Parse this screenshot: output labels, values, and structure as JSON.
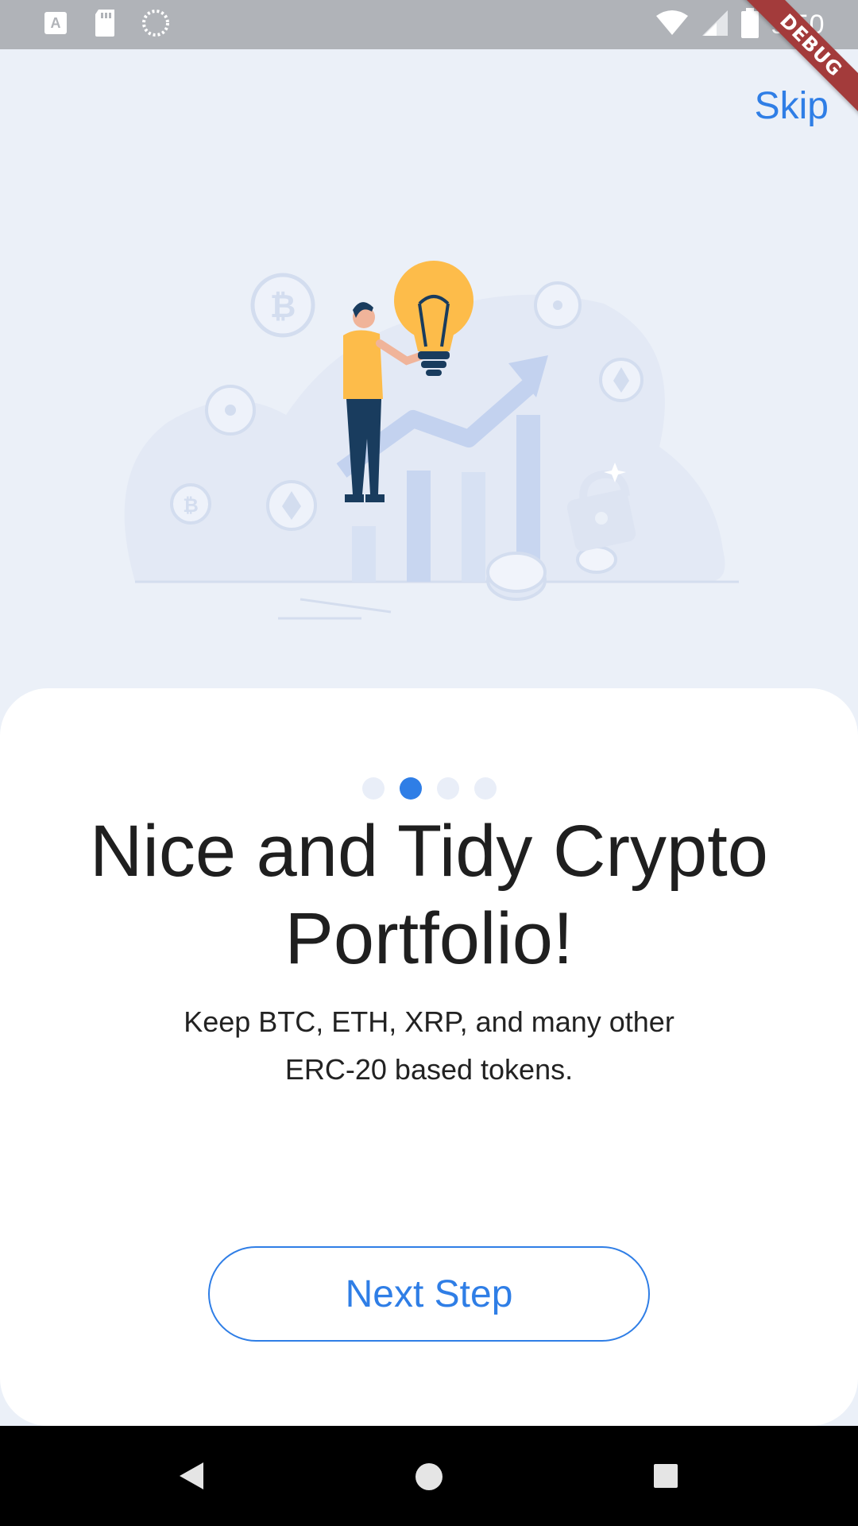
{
  "status_bar": {
    "time": "9:50"
  },
  "debug_banner": "DEBUG",
  "header": {
    "skip_label": "Skip"
  },
  "pager": {
    "total": 4,
    "active_index": 1
  },
  "onboarding": {
    "title": "Nice and Tidy Crypto Portfolio!",
    "subtitle": "Keep BTC, ETH, XRP, and many other ERC-20 based tokens.",
    "next_label": "Next Step"
  },
  "colors": {
    "accent": "#2f7ee6",
    "background": "#ebf0f8",
    "card": "#ffffff"
  }
}
